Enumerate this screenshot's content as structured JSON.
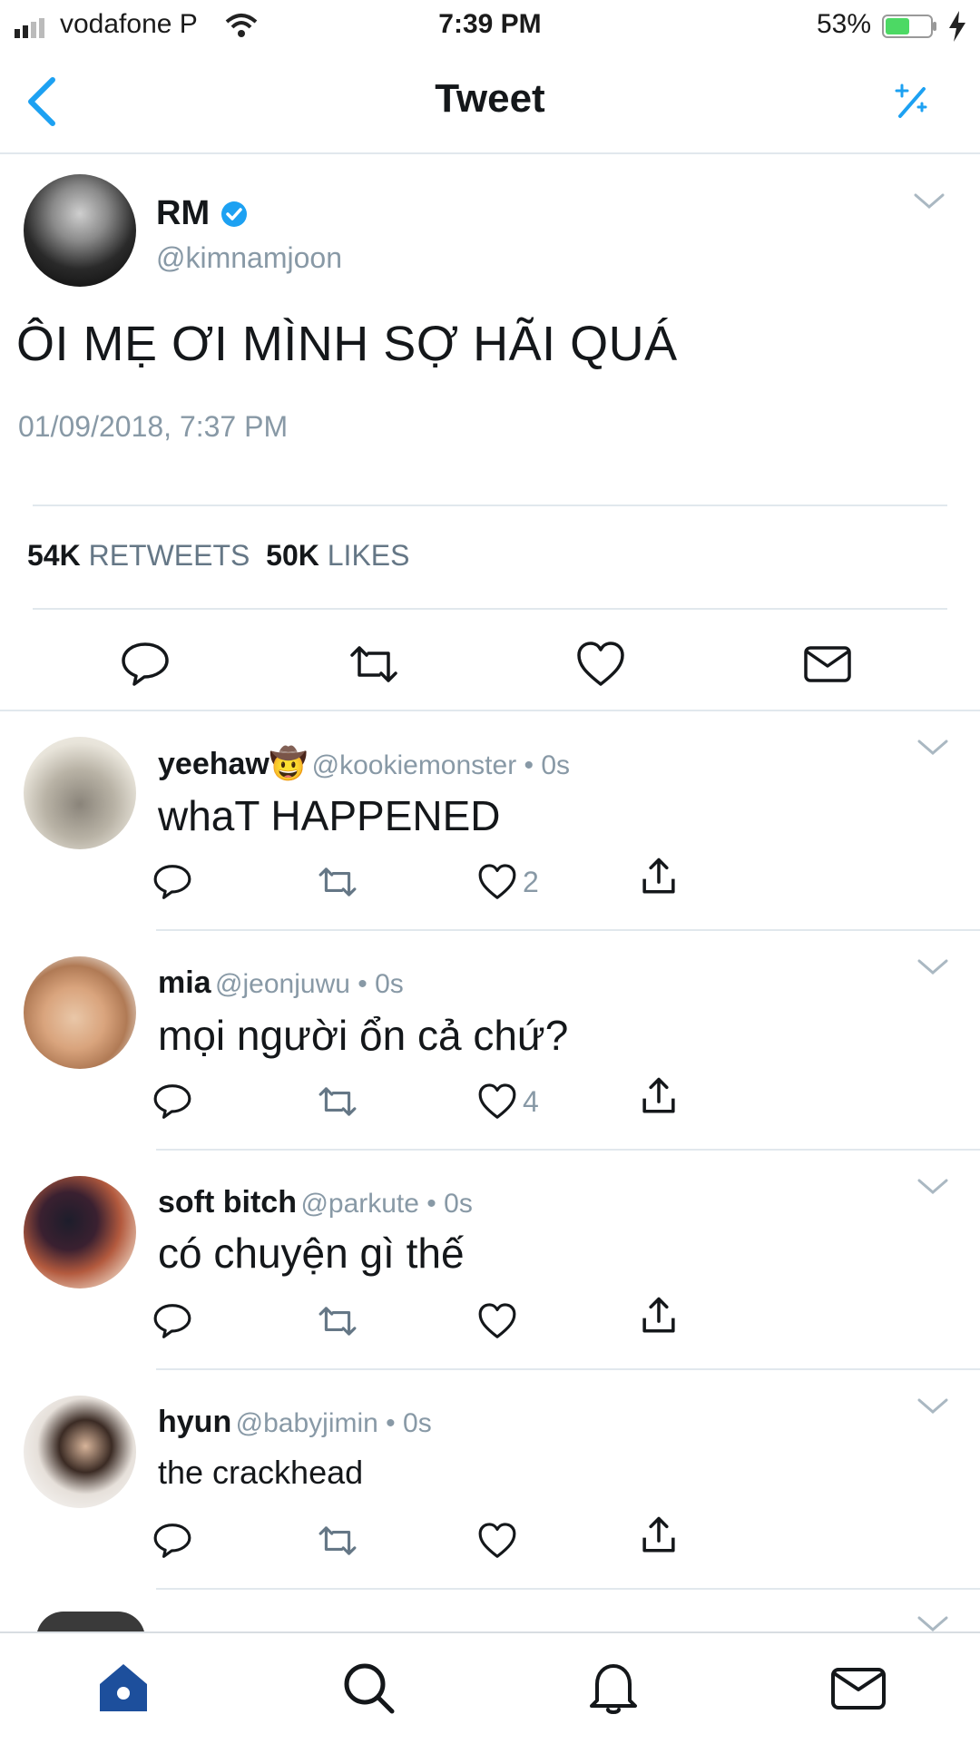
{
  "status_bar": {
    "carrier": "vodafone P",
    "time": "7:39 PM",
    "battery": "53%",
    "battery_level": 0.53
  },
  "nav": {
    "title": "Tweet",
    "back_icon": "chevron-left-icon",
    "sparkle_icon": "sparkle-icon"
  },
  "tweet": {
    "name": "RM",
    "handle": "@kimnamjoon",
    "text": "ÔI MẸ ƠI MÌNH SỢ HÃI QUÁ",
    "timestamp": "01/09/2018, 7:37 PM",
    "retweets_count": "54K",
    "retweets_label": "RETWEETS",
    "likes_count": "50K",
    "likes_label": "LIKES"
  },
  "replies": [
    {
      "name": "yeehaw🤠",
      "handle": "@kookiemonster • 0s",
      "text": "whaT HAPPENED",
      "likes": "2"
    },
    {
      "name": "mia",
      "handle": "@jeonjuwu • 0s",
      "text": "mọi người ổn cả chứ?",
      "likes": "4"
    },
    {
      "name": "soft bitch",
      "handle": "@parkute • 0s",
      "text": "có chuyện gì thế",
      "likes": ""
    },
    {
      "name": "hyun",
      "handle": "@babyjimin • 0s",
      "text": "the crackhead",
      "likes": ""
    }
  ],
  "colors": {
    "accent": "#1da1f2",
    "tab_active": "#1d4f9c",
    "muted": "#8899a6",
    "divider": "#e1e8ed"
  }
}
